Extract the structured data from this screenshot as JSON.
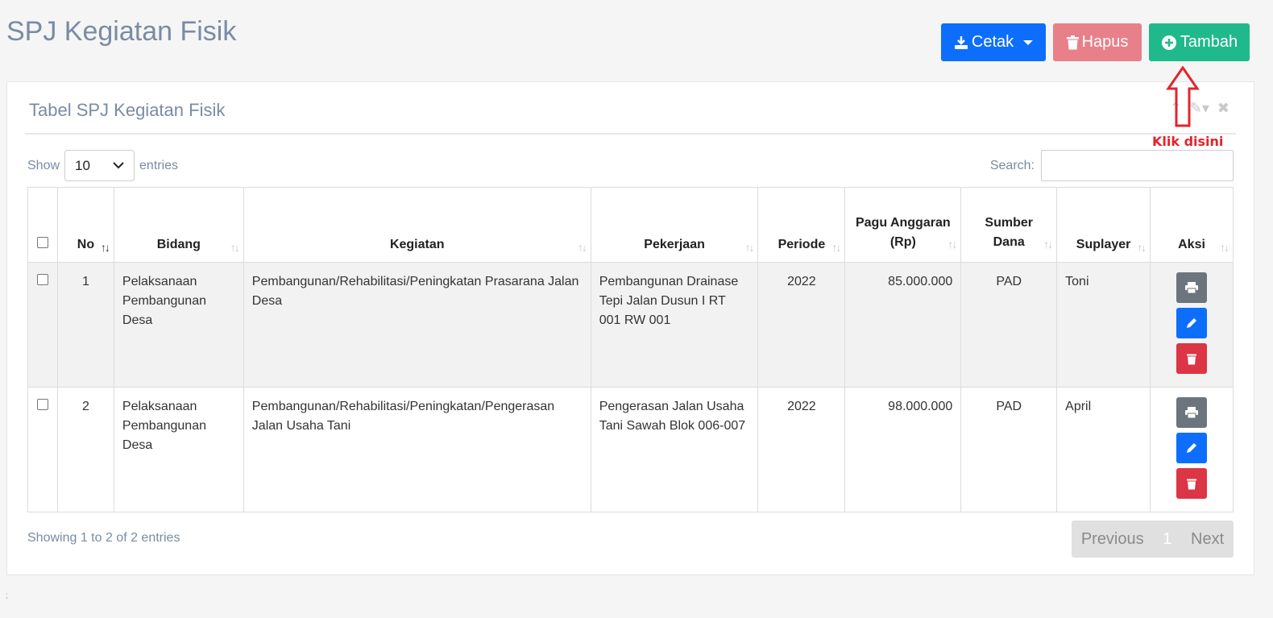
{
  "page": {
    "title": "SPJ Kegiatan Fisik"
  },
  "actions": {
    "cetak_label": "Cetak",
    "hapus_label": "Hapus",
    "tambah_label": "Tambah"
  },
  "card": {
    "title": "Tabel SPJ Kegiatan Fisik"
  },
  "length_menu": {
    "show_label": "Show",
    "value": "10",
    "entries_label": "entries"
  },
  "search": {
    "label": "Search:",
    "value": ""
  },
  "table": {
    "columns": [
      "No",
      "Bidang",
      "Kegiatan",
      "Pekerjaan",
      "Periode",
      "Pagu Anggaran (Rp)",
      "Sumber Dana",
      "Suplayer",
      "Aksi"
    ],
    "rows": [
      {
        "no": "1",
        "bidang": "Pelaksanaan Pembangunan Desa",
        "kegiatan": "Pembangunan/Rehabilitasi/Peningkatan Prasarana Jalan Desa",
        "pekerjaan": "Pembangunan Drainase Tepi Jalan Dusun I RT 001 RW 001",
        "periode": "2022",
        "pagu": "85.000.000",
        "sumber": "PAD",
        "suplayer": "Toni"
      },
      {
        "no": "2",
        "bidang": "Pelaksanaan Pembangunan Desa",
        "kegiatan": "Pembangunan/Rehabilitasi/Peningkatan/Pengerasan Jalan Usaha Tani",
        "pekerjaan": "Pengerasan Jalan Usaha Tani Sawah Blok 006-007",
        "periode": "2022",
        "pagu": "98.000.000",
        "sumber": "PAD",
        "suplayer": "April"
      }
    ]
  },
  "info": "Showing 1 to 2 of 2 entries",
  "pagination": {
    "previous": "Previous",
    "current": "1",
    "next": "Next"
  },
  "annotation": {
    "text": "Klik disini"
  },
  "footer_mark": ";",
  "colors": {
    "primary": "#0d6efd",
    "danger_light": "#e8808a",
    "success": "#20b98b",
    "secondary": "#6c757d",
    "danger": "#dc3545",
    "annotation": "#e3242b"
  }
}
